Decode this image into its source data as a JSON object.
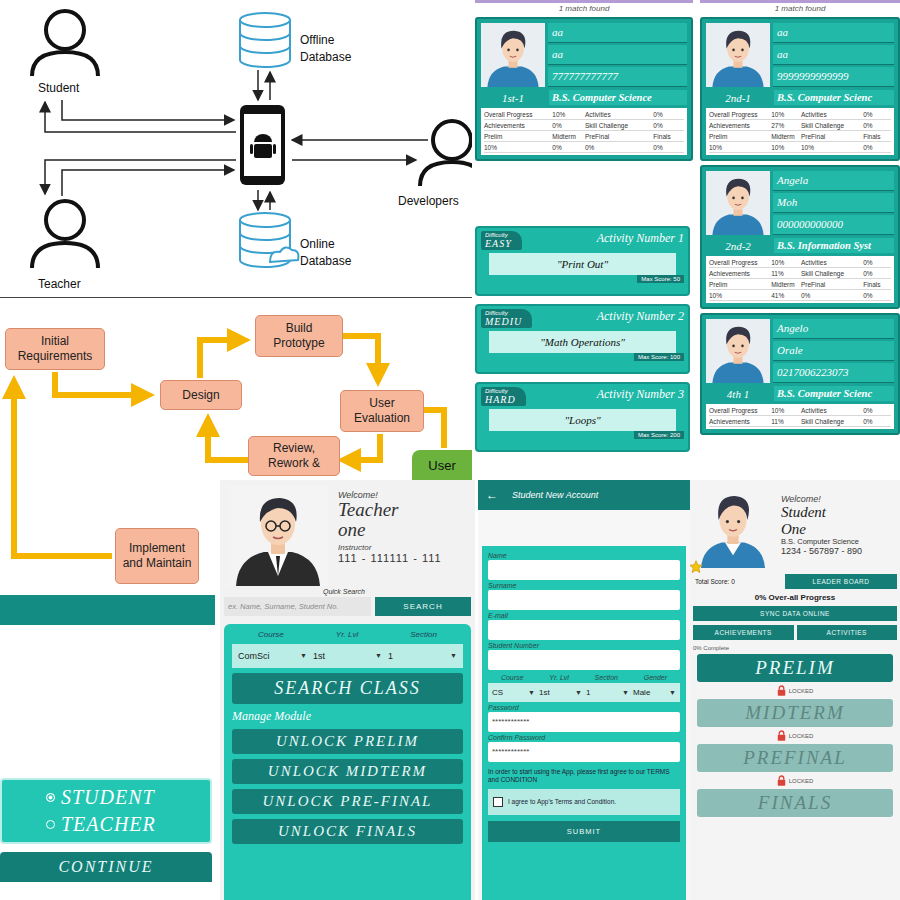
{
  "architecture_diagram": {
    "student": "Student",
    "teacher": "Teacher",
    "developers": "Developers",
    "offline_database": "Offline Database",
    "online_database": "Online Database"
  },
  "prototyping_diagram": {
    "steps": [
      "Initial Requirements",
      "Design",
      "Build Prototype",
      "User Evaluation",
      "Review, Rework &",
      "Implement and Maintain"
    ],
    "user": "User"
  },
  "search_results": [
    {
      "header": "1 match found",
      "students": [
        {
          "name": "aa",
          "surname": "aa",
          "number": "777777777777",
          "section": "1st-1",
          "course": "B.S. Computer Science",
          "stats": [
            [
              "Overall Progress",
              "10%",
              "Activities",
              "0%"
            ],
            [
              "Achievements",
              "0%",
              "Skill Challenge",
              "0%"
            ],
            [
              "Prelim",
              "Midterm",
              "PreFinal",
              "Finals"
            ],
            [
              "10%",
              "0%",
              "0%",
              "0%"
            ]
          ]
        }
      ]
    },
    {
      "header": "1 match found",
      "students": [
        {
          "name": "aa",
          "surname": "aa",
          "number": "9999999999999",
          "section": "2nd-1",
          "course": "B.S. Computer Scienc",
          "stats": [
            [
              "Overall Progress",
              "10%",
              "Activities",
              "0%"
            ],
            [
              "Achievements",
              "27%",
              "Skill Challenge",
              "0%"
            ],
            [
              "Prelim",
              "Midterm",
              "PreFinal",
              "Finals"
            ],
            [
              "10%",
              "10%",
              "10%",
              "0%"
            ]
          ]
        },
        {
          "name": "Angela",
          "surname": "Moh",
          "number": "000000000000",
          "section": "2nd-2",
          "course": "B.S. Information Syst",
          "stats": [
            [
              "Overall Progress",
              "10%",
              "Activities",
              "0%"
            ],
            [
              "Achievements",
              "11%",
              "Skill Challenge",
              "0%"
            ],
            [
              "Prelim",
              "Midterm",
              "PreFinal",
              "Finals"
            ],
            [
              "10%",
              "41%",
              "0%",
              "0%"
            ]
          ]
        },
        {
          "name": "Angelo",
          "surname": "Orale",
          "number": "0217006223073",
          "section": "4th 1",
          "course": "B.S. Computer Scienc",
          "stats": [
            [
              "Overall Progress",
              "10%",
              "Activities",
              "0%"
            ],
            [
              "Achievements",
              "11%",
              "Skill Challenge",
              "0%"
            ]
          ]
        }
      ]
    }
  ],
  "activities": [
    {
      "difficulty_label": "Difficulty",
      "difficulty": "EASY",
      "title": "Activity Number 1",
      "name": "\"Print Out\"",
      "max_score": "Max Score: 50"
    },
    {
      "difficulty_label": "Difficulty",
      "difficulty": "MEDIU",
      "title": "Activity Number 2",
      "name": "\"Math Operations\"",
      "max_score": "Max Score: 100"
    },
    {
      "difficulty_label": "Difficulty",
      "difficulty": "HARD",
      "title": "Activity Number 3",
      "name": "\"Loops\"",
      "max_score": "Max Score: 200"
    }
  ],
  "teacher_home": {
    "welcome": "Welcome!",
    "first_name": "Teacher",
    "last_name": "one",
    "role": "Instructor",
    "id_number": "111 - 111111 - 111",
    "quick_search_label": "Quick Search",
    "search_placeholder": "ex. Name, Surname, Student No.",
    "search_button": "SEARCH",
    "filters": [
      {
        "label": "Course",
        "value": "ComSci"
      },
      {
        "label": "Yr. Lvl",
        "value": "1st"
      },
      {
        "label": "Section",
        "value": "1"
      }
    ],
    "dropdown_arrow": "▼",
    "search_class_button": "SEARCH CLASS",
    "manage_label": "Manage Module",
    "unlock_buttons": [
      "UNLOCK PRELIM",
      "UNLOCK MIDTERM",
      "UNLOCK PRE-FINAL",
      "UNLOCK FINALS"
    ]
  },
  "new_account": {
    "back": "←",
    "title": "Student New Account",
    "fields": [
      "Name",
      "Surname",
      "E-mail",
      "Student Number"
    ],
    "selects": [
      {
        "label": "Course",
        "value": "CS"
      },
      {
        "label": "Yr. Lvl",
        "value": "1st"
      },
      {
        "label": "Section",
        "value": "1"
      },
      {
        "label": "Gender",
        "value": "Male"
      }
    ],
    "dropdown_arrow": "▼",
    "password_fields": [
      {
        "label": "Password",
        "value": "************"
      },
      {
        "label": "Confirm Password",
        "value": "************"
      }
    ],
    "terms_text": "In order to start using the App, please first agree to our TERMS and CONDITION",
    "agree_label": "I agree to App's Terms and Condition.",
    "agree_checked": false,
    "submit": "SUBMIT"
  },
  "student_home": {
    "welcome": "Welcome!",
    "first_name": "Student",
    "last_name": "One",
    "course": "B.S. Computer Science",
    "id_number": "1234 - 567897 - 890",
    "total_score": "Total Score: 0",
    "leaderboard_button": "LEADER BOARD",
    "progress": "0% Over-all Progress",
    "sync_button": "SYNC DATA ONLINE",
    "buttons": [
      "ACHIEVEMENTS",
      "ACTIVITIES"
    ],
    "complete": "0% Complete",
    "locked_label": "LOCKED",
    "modules": [
      {
        "label": "PRELIM",
        "locked": false
      },
      {
        "label": "MIDTERM",
        "locked": true
      },
      {
        "label": "PREFINAL",
        "locked": true
      },
      {
        "label": "FINALS",
        "locked": true
      }
    ]
  },
  "role_select": {
    "options": [
      {
        "label": "STUDENT",
        "selected": true
      },
      {
        "label": "TEACHER",
        "selected": false
      }
    ],
    "button": "CONTINUE"
  }
}
